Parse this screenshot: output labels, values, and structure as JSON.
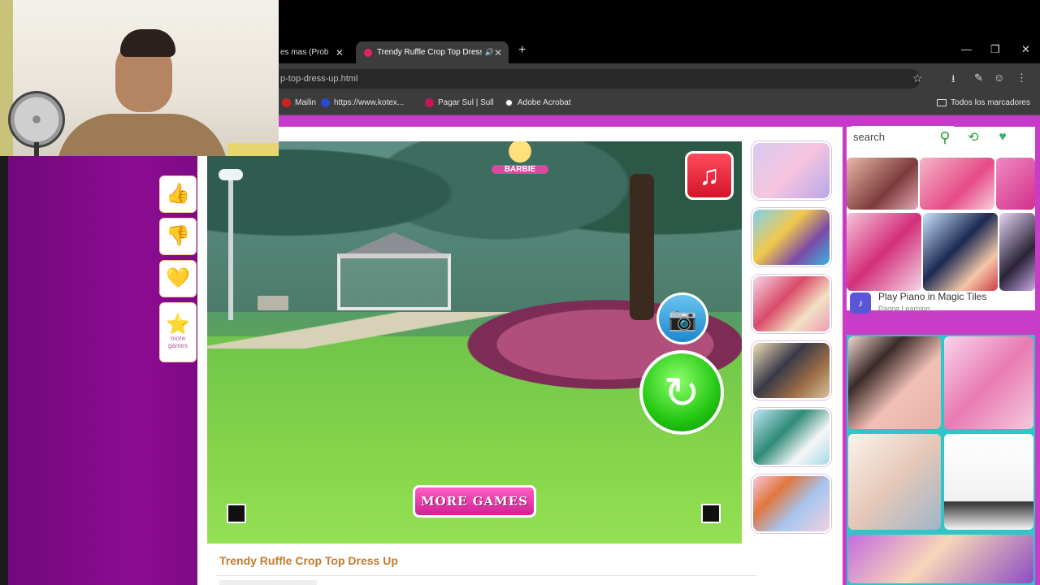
{
  "tabs": [
    {
      "label": "es mas (Prob",
      "active": false
    },
    {
      "label": "Trendy Ruffle Crop Top Dress",
      "active": true
    }
  ],
  "address_bar": {
    "url": "p-top-dress-up.html"
  },
  "bookmarks": [
    {
      "label": "Mailin",
      "icon": "mail-icon"
    },
    {
      "label": "https://www.kotex...",
      "icon": "link-icon"
    },
    {
      "label": "Pagar Sul | Sull",
      "icon": "payment-icon"
    },
    {
      "label": "Adobe Acrobat",
      "icon": "acrobat-icon"
    }
  ],
  "bookmarks_folder": "Todos los marcadores",
  "side_buttons": [
    {
      "icon": "thumbs-up-icon",
      "glyph": "👍"
    },
    {
      "icon": "thumbs-down-icon",
      "glyph": "👎"
    },
    {
      "icon": "heart-icon",
      "glyph": "💛"
    },
    {
      "icon": "star-icon",
      "glyph": "⭐",
      "label": "more games"
    }
  ],
  "game": {
    "logo": "BARBIE",
    "more_games_label": "MORE GAMES",
    "music_glyph": "♫",
    "camera_glyph": "📷",
    "replay_glyph": "↻"
  },
  "search": {
    "placeholder": "search",
    "value": "search"
  },
  "ad": {
    "title": "Play Piano in Magic Tiles",
    "subtitle": "Panpa Learning",
    "logo_glyph": "♪"
  },
  "page_title": "Trendy Ruffle Crop Top Dress Up",
  "colors": {
    "purple_side": "#80098a",
    "ad_panel": "#c93cc8",
    "title": "#c27a2b",
    "more_games": "#d31f95"
  }
}
